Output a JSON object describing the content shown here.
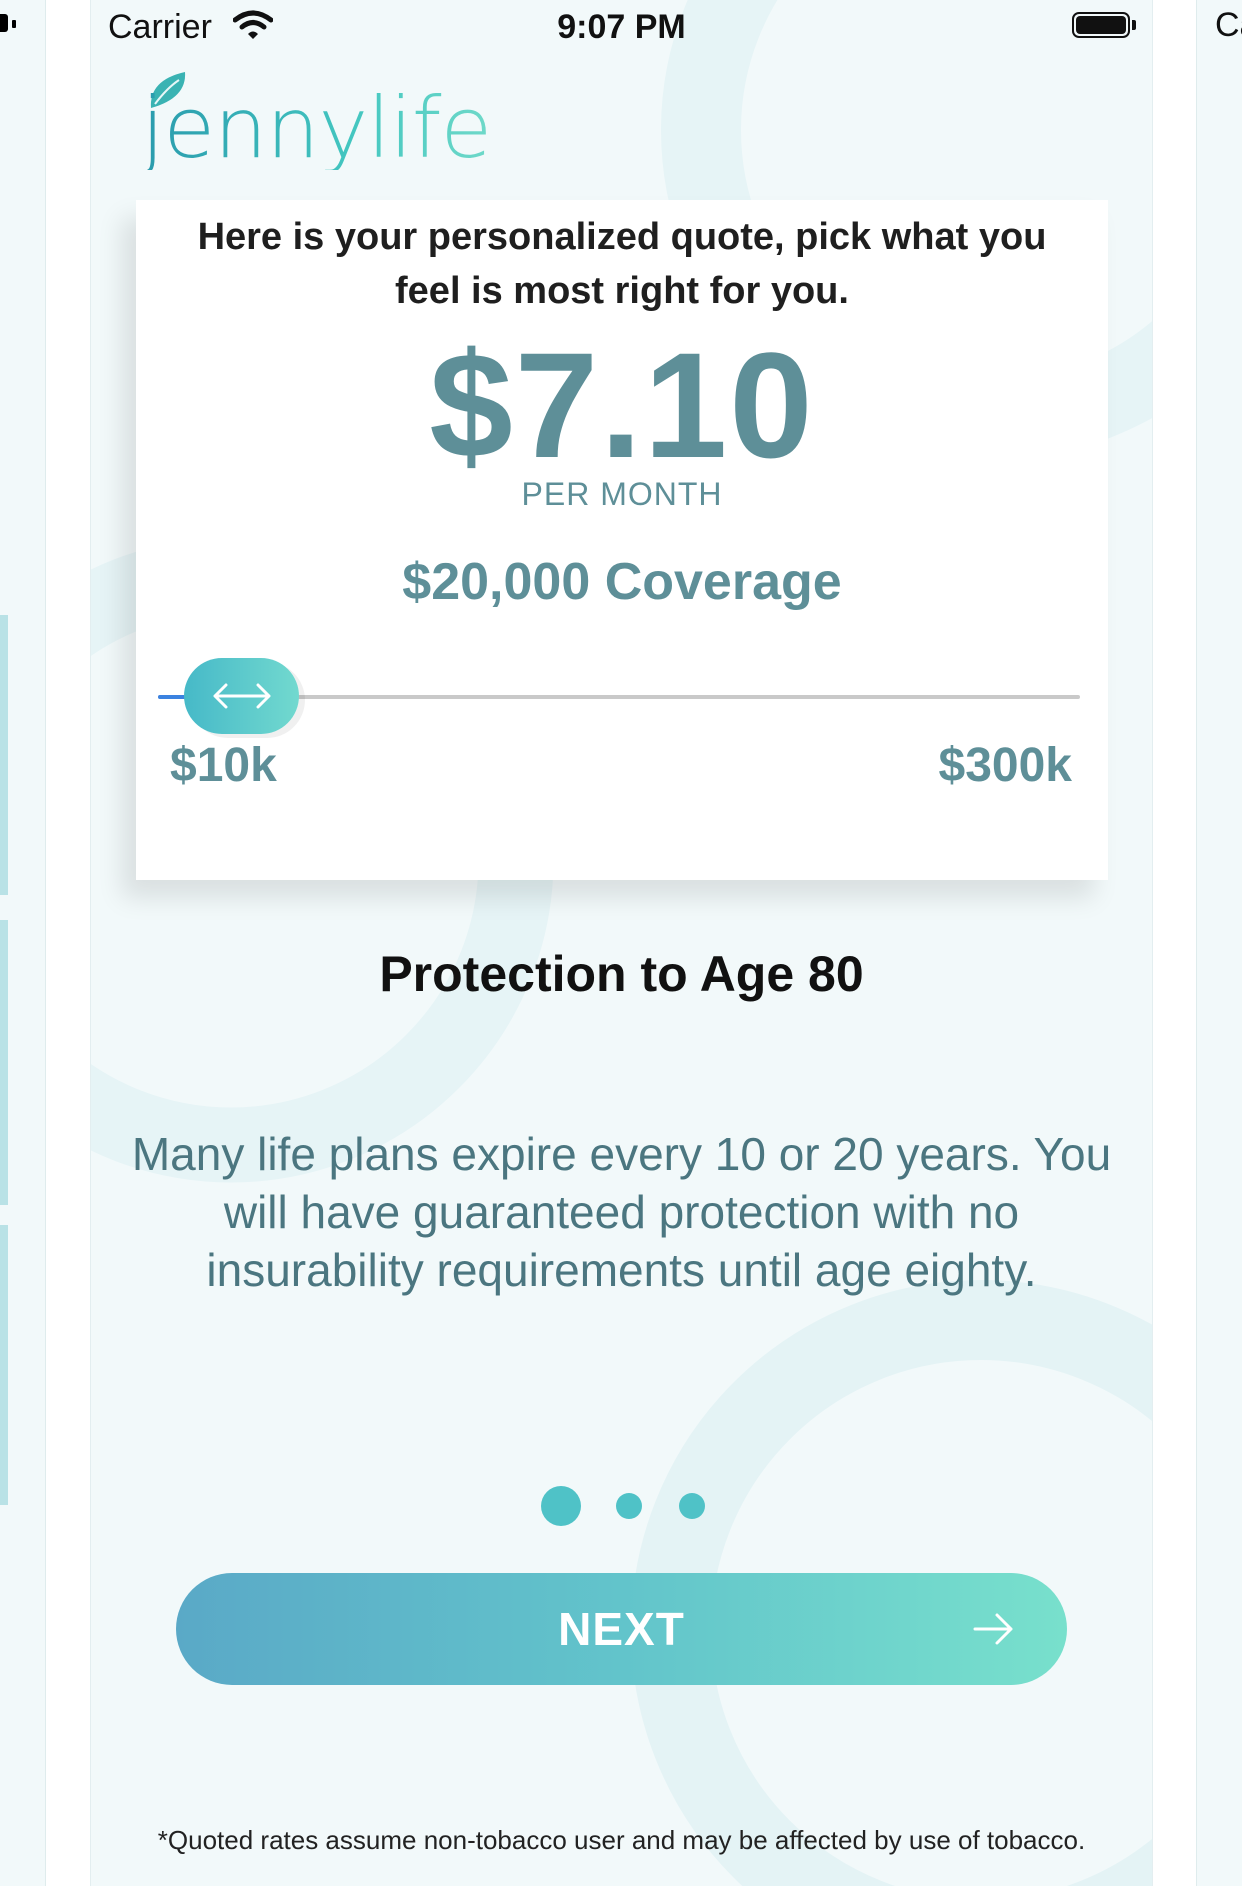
{
  "status_bar": {
    "carrier": "Carrier",
    "time": "9:07 PM"
  },
  "logo": {
    "text": "jennylife"
  },
  "quote": {
    "intro": "Here is your personalized quote, pick what you feel is most right for you.",
    "price": "$7.10",
    "period": "PER MONTH",
    "coverage": "$20,000 Coverage",
    "slider": {
      "min_label": "$10k",
      "max_label": "$300k",
      "value_fraction": 0.03
    }
  },
  "protection": {
    "title": "Protection to Age 80",
    "description": "Many life plans expire every 10 or 20 years. You will have guaranteed protection with no insurability requirements until age eighty."
  },
  "pagination": {
    "total": 3,
    "active_index": 0
  },
  "next_button": {
    "label": "NEXT",
    "icon": "arrow-right-icon"
  },
  "disclaimer": "*Quoted rates assume non-tobacco user and may be affected by use of tobacco.",
  "peek_right": {
    "carrier_fragment": "Ca"
  },
  "colors": {
    "accent_teal": "#4fc2c7",
    "text_muted": "#5e8f98",
    "background": "#f2f9fa",
    "slider_fill": "#3b82e0"
  }
}
